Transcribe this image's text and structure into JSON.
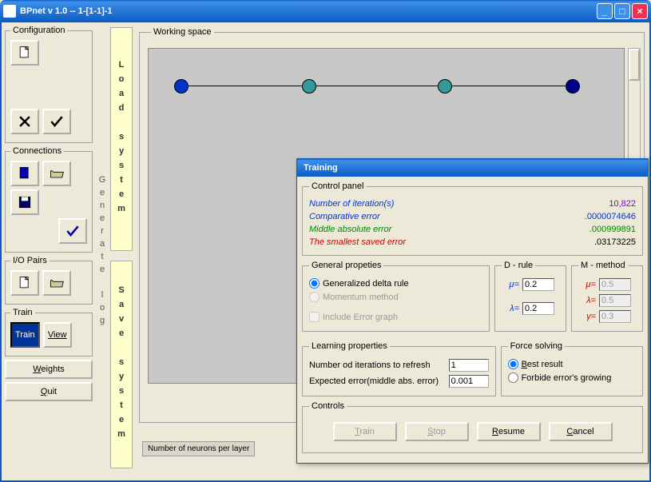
{
  "window": {
    "title": "BPnet v 1.0   --   1-[1-1]-1"
  },
  "left": {
    "config": {
      "legend": "Configuration"
    },
    "conn": {
      "legend": "Connections"
    },
    "io": {
      "legend": "I/O Pairs"
    },
    "train": {
      "legend": "Train",
      "train_btn": "Train",
      "view_btn": "View"
    },
    "weights": "Weights",
    "quit": "Quit"
  },
  "strips": {
    "generate": "Generate log",
    "load": "Load system",
    "save": "Save system"
  },
  "work": {
    "legend": "Working space",
    "bottomtab": "Number of neurons per layer"
  },
  "dlg": {
    "title": "Training",
    "cp": {
      "legend": "Control panel",
      "iter_lbl": "Number of iteration(s)",
      "iter_val": "10,822",
      "comp_lbl": "Comparative error",
      "comp_val": ".0000074646",
      "mid_lbl": "Middle absolute error",
      "mid_val": ".000999891",
      "small_lbl": "The smallest saved error",
      "small_val": ".03173225"
    },
    "gp": {
      "legend": "General propeties",
      "delta": "Generalized delta rule",
      "mom": "Momentum method",
      "inc": "Include Error graph"
    },
    "dr": {
      "legend": "D - rule",
      "mu": "μ=",
      "mu_v": "0.2",
      "la": "λ=",
      "la_v": "0.2"
    },
    "mm": {
      "legend": "M - method",
      "mu": "μ=",
      "mu_v": "0.5",
      "la": "λ=",
      "la_v": "0.5",
      "ga": "γ=",
      "ga_v": "0.3"
    },
    "lp": {
      "legend": "Learning properties",
      "ref": "Number od iterations to refresh",
      "ref_v": "1",
      "exp": "Expected error(middle abs. error)",
      "exp_v": "0.001"
    },
    "fs": {
      "legend": "Force solving",
      "best": "Best result",
      "forb": "Forbide error's growing"
    },
    "ctrl": {
      "legend": "Controls",
      "train": "Train",
      "stop": "Stop",
      "resume": "Resume",
      "cancel": "Cancel"
    }
  }
}
